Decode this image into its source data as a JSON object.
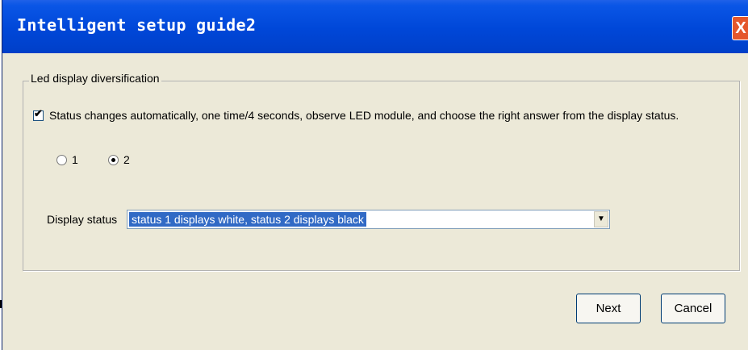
{
  "window": {
    "title": "Intelligent setup guide2",
    "close_label": "X"
  },
  "group": {
    "legend": "Led display diversification",
    "checkbox": {
      "checked": true,
      "label": "Status changes automatically, one time/4 seconds, observe LED module, and choose the right answer from the display status."
    },
    "radios": [
      {
        "label": "1",
        "selected": false
      },
      {
        "label": "2",
        "selected": true
      }
    ],
    "display_status": {
      "label": "Display status",
      "value": "status 1 displays white, status 2 displays black"
    }
  },
  "buttons": {
    "next": "Next",
    "cancel": "Cancel"
  }
}
